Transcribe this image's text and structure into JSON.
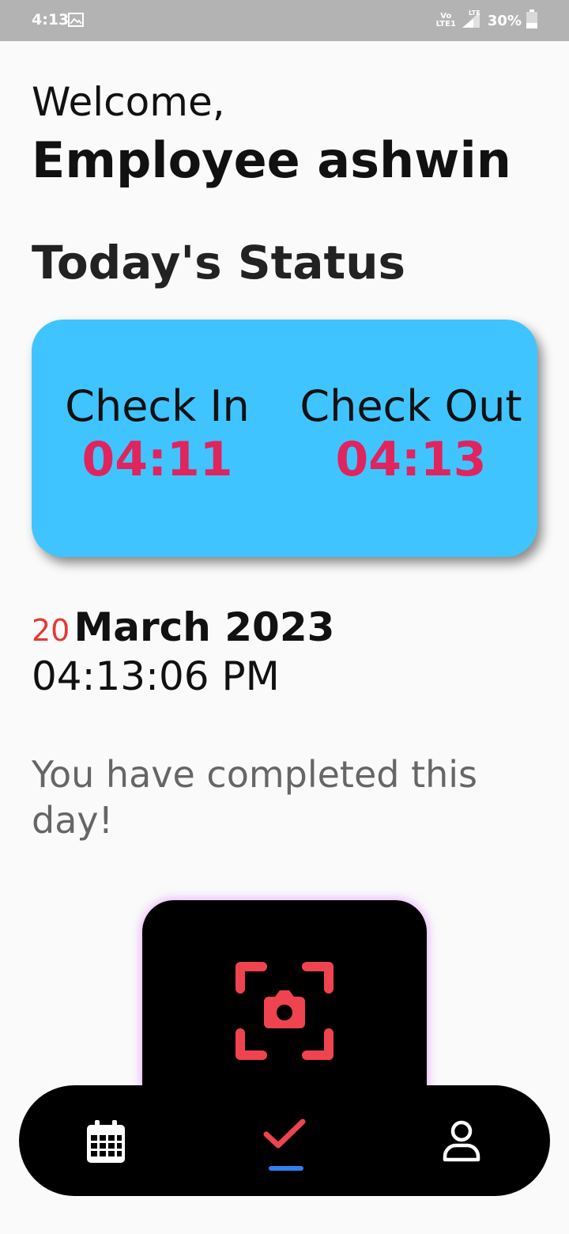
{
  "status_bar": {
    "time": "4:13",
    "network_top": "Vo",
    "network_bottom": "LTE1",
    "network_type": "LTE",
    "battery": "30%"
  },
  "greeting": {
    "welcome": "Welcome,",
    "name": "Employee ashwin"
  },
  "status_section": {
    "title": "Today's Status",
    "check_in_label": "Check In",
    "check_in_time": "04:11",
    "check_out_label": "Check Out",
    "check_out_time": "04:13"
  },
  "date_info": {
    "day": "20",
    "month_year": "March 2023",
    "clock": "04:13:06 PM"
  },
  "message": "You have completed this day!",
  "nav": {
    "items": [
      "calendar-icon",
      "check-icon",
      "profile-icon"
    ],
    "active": "check-icon"
  },
  "colors": {
    "card_bg": "#40c4ff",
    "time_accent": "#e0245e",
    "day_accent": "#e53935",
    "scan_icon": "#ef4350",
    "nav_indicator": "#2f80ed"
  }
}
